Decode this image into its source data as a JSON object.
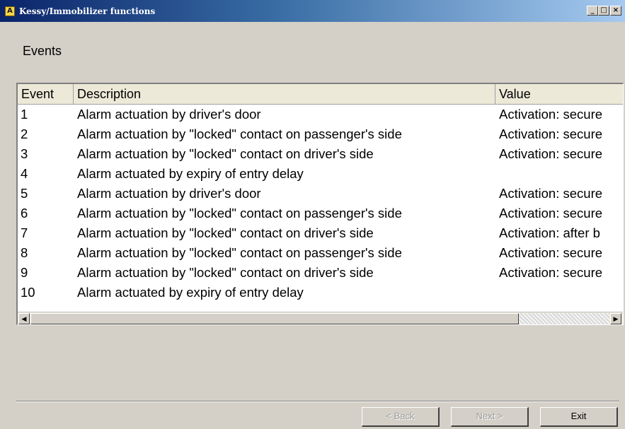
{
  "window": {
    "title": "Kessy/Immobilizer functions",
    "icon_letter": "A",
    "controls": {
      "minimize": "_",
      "maximize": "□",
      "close": "×"
    }
  },
  "page": {
    "heading": "Events"
  },
  "table": {
    "columns": [
      "Event",
      "Description",
      "Value"
    ],
    "rows": [
      {
        "event": "1",
        "description": "Alarm actuation by driver's door",
        "value": "Activation: secure"
      },
      {
        "event": "2",
        "description": "Alarm actuation by \"locked\" contact on passenger's side",
        "value": "Activation: secure"
      },
      {
        "event": "3",
        "description": "Alarm actuation by \"locked\" contact on driver's side",
        "value": "Activation: secure"
      },
      {
        "event": "4",
        "description": "Alarm actuated by expiry of entry delay",
        "value": ""
      },
      {
        "event": "5",
        "description": "Alarm actuation by driver's door",
        "value": "Activation: secure"
      },
      {
        "event": "6",
        "description": "Alarm actuation by \"locked\" contact on passenger's side",
        "value": "Activation: secure"
      },
      {
        "event": "7",
        "description": "Alarm actuation by \"locked\" contact on driver's side",
        "value": "Activation: after b"
      },
      {
        "event": "8",
        "description": "Alarm actuation by \"locked\" contact on passenger's side",
        "value": "Activation: secure"
      },
      {
        "event": "9",
        "description": "Alarm actuation by \"locked\" contact on driver's side",
        "value": "Activation: secure"
      },
      {
        "event": "10",
        "description": "Alarm actuated by expiry of entry delay",
        "value": ""
      }
    ]
  },
  "scrollbar": {
    "left_arrow": "◀",
    "right_arrow": "▶"
  },
  "buttons": {
    "back": "< Back",
    "next": "Next >",
    "exit": "Exit"
  },
  "colors": {
    "titlebar_start": "#0a246a",
    "titlebar_end": "#a6caf0",
    "face": "#d4d0c8",
    "list_bg": "#ffffff"
  }
}
